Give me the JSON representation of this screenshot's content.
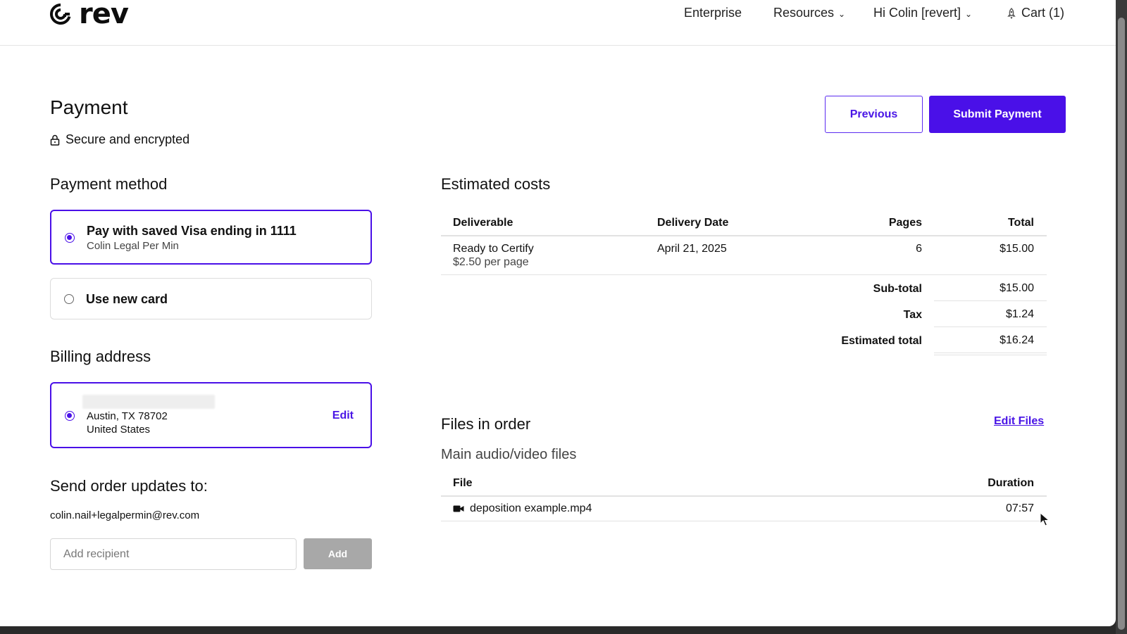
{
  "header": {
    "brand": "rev",
    "nav": {
      "enterprise": "Enterprise",
      "resources": "Resources",
      "user": "Hi Colin [revert]",
      "cart": "Cart (1)"
    }
  },
  "page": {
    "title": "Payment",
    "secure_label": "Secure and encrypted",
    "previous_label": "Previous",
    "submit_label": "Submit Payment"
  },
  "payment_method": {
    "heading": "Payment method",
    "saved": {
      "title": "Pay with saved Visa ending in 1111",
      "subtitle": "Colin Legal Per Min",
      "selected": true
    },
    "new_card": {
      "title": "Use new card",
      "selected": false
    }
  },
  "billing": {
    "heading": "Billing address",
    "line1": "Austin, TX 78702",
    "line2": "United States",
    "edit_label": "Edit"
  },
  "updates": {
    "heading": "Send order updates to:",
    "email": "colin.nail+legalpermin@rev.com",
    "input_placeholder": "Add recipient",
    "add_label": "Add"
  },
  "costs": {
    "heading": "Estimated costs",
    "columns": [
      "Deliverable",
      "Delivery Date",
      "Pages",
      "Total"
    ],
    "rows": [
      {
        "deliverable": "Ready to Certify",
        "rate": "$2.50 per page",
        "delivery_date": "April 21, 2025",
        "pages": "6",
        "total": "$15.00"
      }
    ],
    "subtotal_label": "Sub-total",
    "subtotal": "$15.00",
    "tax_label": "Tax",
    "tax": "$1.24",
    "estimated_total_label": "Estimated total",
    "estimated_total": "$16.24"
  },
  "files": {
    "heading": "Files in order",
    "edit_label": "Edit Files",
    "subheading": "Main audio/video files",
    "columns": [
      "File",
      "Duration"
    ],
    "rows": [
      {
        "name": "deposition example.mp4",
        "duration": "07:57",
        "icon": "video-camera-icon"
      }
    ]
  },
  "colors": {
    "accent": "#4a10e8",
    "disabled": "#a8a8a8",
    "border": "#dcdcdc"
  }
}
